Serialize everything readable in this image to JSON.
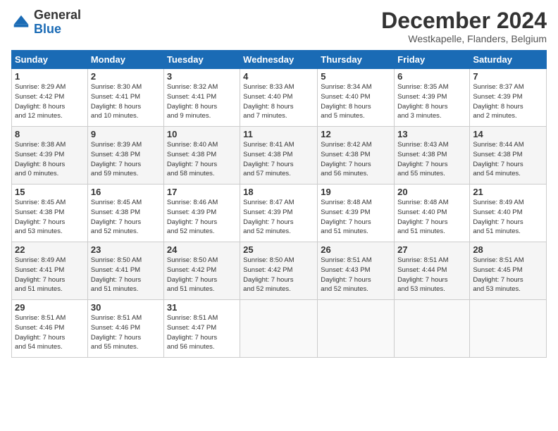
{
  "header": {
    "logo_line1": "General",
    "logo_line2": "Blue",
    "title": "December 2024",
    "subtitle": "Westkapelle, Flanders, Belgium"
  },
  "weekdays": [
    "Sunday",
    "Monday",
    "Tuesday",
    "Wednesday",
    "Thursday",
    "Friday",
    "Saturday"
  ],
  "weeks": [
    [
      {
        "day": "1",
        "text": "Sunrise: 8:29 AM\nSunset: 4:42 PM\nDaylight: 8 hours\nand 12 minutes."
      },
      {
        "day": "2",
        "text": "Sunrise: 8:30 AM\nSunset: 4:41 PM\nDaylight: 8 hours\nand 10 minutes."
      },
      {
        "day": "3",
        "text": "Sunrise: 8:32 AM\nSunset: 4:41 PM\nDaylight: 8 hours\nand 9 minutes."
      },
      {
        "day": "4",
        "text": "Sunrise: 8:33 AM\nSunset: 4:40 PM\nDaylight: 8 hours\nand 7 minutes."
      },
      {
        "day": "5",
        "text": "Sunrise: 8:34 AM\nSunset: 4:40 PM\nDaylight: 8 hours\nand 5 minutes."
      },
      {
        "day": "6",
        "text": "Sunrise: 8:35 AM\nSunset: 4:39 PM\nDaylight: 8 hours\nand 3 minutes."
      },
      {
        "day": "7",
        "text": "Sunrise: 8:37 AM\nSunset: 4:39 PM\nDaylight: 8 hours\nand 2 minutes."
      }
    ],
    [
      {
        "day": "8",
        "text": "Sunrise: 8:38 AM\nSunset: 4:39 PM\nDaylight: 8 hours\nand 0 minutes."
      },
      {
        "day": "9",
        "text": "Sunrise: 8:39 AM\nSunset: 4:38 PM\nDaylight: 7 hours\nand 59 minutes."
      },
      {
        "day": "10",
        "text": "Sunrise: 8:40 AM\nSunset: 4:38 PM\nDaylight: 7 hours\nand 58 minutes."
      },
      {
        "day": "11",
        "text": "Sunrise: 8:41 AM\nSunset: 4:38 PM\nDaylight: 7 hours\nand 57 minutes."
      },
      {
        "day": "12",
        "text": "Sunrise: 8:42 AM\nSunset: 4:38 PM\nDaylight: 7 hours\nand 56 minutes."
      },
      {
        "day": "13",
        "text": "Sunrise: 8:43 AM\nSunset: 4:38 PM\nDaylight: 7 hours\nand 55 minutes."
      },
      {
        "day": "14",
        "text": "Sunrise: 8:44 AM\nSunset: 4:38 PM\nDaylight: 7 hours\nand 54 minutes."
      }
    ],
    [
      {
        "day": "15",
        "text": "Sunrise: 8:45 AM\nSunset: 4:38 PM\nDaylight: 7 hours\nand 53 minutes."
      },
      {
        "day": "16",
        "text": "Sunrise: 8:45 AM\nSunset: 4:38 PM\nDaylight: 7 hours\nand 52 minutes."
      },
      {
        "day": "17",
        "text": "Sunrise: 8:46 AM\nSunset: 4:39 PM\nDaylight: 7 hours\nand 52 minutes."
      },
      {
        "day": "18",
        "text": "Sunrise: 8:47 AM\nSunset: 4:39 PM\nDaylight: 7 hours\nand 52 minutes."
      },
      {
        "day": "19",
        "text": "Sunrise: 8:48 AM\nSunset: 4:39 PM\nDaylight: 7 hours\nand 51 minutes."
      },
      {
        "day": "20",
        "text": "Sunrise: 8:48 AM\nSunset: 4:40 PM\nDaylight: 7 hours\nand 51 minutes."
      },
      {
        "day": "21",
        "text": "Sunrise: 8:49 AM\nSunset: 4:40 PM\nDaylight: 7 hours\nand 51 minutes."
      }
    ],
    [
      {
        "day": "22",
        "text": "Sunrise: 8:49 AM\nSunset: 4:41 PM\nDaylight: 7 hours\nand 51 minutes."
      },
      {
        "day": "23",
        "text": "Sunrise: 8:50 AM\nSunset: 4:41 PM\nDaylight: 7 hours\nand 51 minutes."
      },
      {
        "day": "24",
        "text": "Sunrise: 8:50 AM\nSunset: 4:42 PM\nDaylight: 7 hours\nand 51 minutes."
      },
      {
        "day": "25",
        "text": "Sunrise: 8:50 AM\nSunset: 4:42 PM\nDaylight: 7 hours\nand 52 minutes."
      },
      {
        "day": "26",
        "text": "Sunrise: 8:51 AM\nSunset: 4:43 PM\nDaylight: 7 hours\nand 52 minutes."
      },
      {
        "day": "27",
        "text": "Sunrise: 8:51 AM\nSunset: 4:44 PM\nDaylight: 7 hours\nand 53 minutes."
      },
      {
        "day": "28",
        "text": "Sunrise: 8:51 AM\nSunset: 4:45 PM\nDaylight: 7 hours\nand 53 minutes."
      }
    ],
    [
      {
        "day": "29",
        "text": "Sunrise: 8:51 AM\nSunset: 4:46 PM\nDaylight: 7 hours\nand 54 minutes."
      },
      {
        "day": "30",
        "text": "Sunrise: 8:51 AM\nSunset: 4:46 PM\nDaylight: 7 hours\nand 55 minutes."
      },
      {
        "day": "31",
        "text": "Sunrise: 8:51 AM\nSunset: 4:47 PM\nDaylight: 7 hours\nand 56 minutes."
      },
      {
        "day": "",
        "text": ""
      },
      {
        "day": "",
        "text": ""
      },
      {
        "day": "",
        "text": ""
      },
      {
        "day": "",
        "text": ""
      }
    ]
  ]
}
